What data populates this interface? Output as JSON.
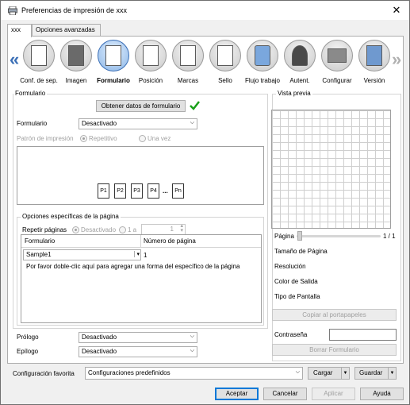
{
  "window": {
    "title": "Preferencias de impresión de xxx",
    "close_glyph": "✕"
  },
  "tabs": [
    {
      "label": "xxx"
    },
    {
      "label": "Opciones avanzadas"
    }
  ],
  "iconbar": {
    "items": [
      {
        "label": "Conf. de sep.",
        "icon": "page-setup-icon"
      },
      {
        "label": "Imagen",
        "icon": "image-icon"
      },
      {
        "label": "Formulario",
        "icon": "form-icon",
        "selected": true
      },
      {
        "label": "Posición",
        "icon": "position-icon"
      },
      {
        "label": "Marcas",
        "icon": "marks-icon"
      },
      {
        "label": "Sello",
        "icon": "stamp-icon"
      },
      {
        "label": "Flujo trabajo",
        "icon": "workflow-icon"
      },
      {
        "label": "Autent.",
        "icon": "authentication-icon"
      },
      {
        "label": "Configurar",
        "icon": "configure-icon"
      },
      {
        "label": "Versión",
        "icon": "version-icon"
      }
    ]
  },
  "formulario": {
    "group_label": "Formulario",
    "obtain_button": "Obtener datos de formulario",
    "form_label": "Formulario",
    "form_value": "Desactivado",
    "pattern_label": "Patrón de impresión",
    "pattern_repeat": "Repetitivo",
    "pattern_once": "Una vez",
    "pages": [
      "P1",
      "P2",
      "P3",
      "P4",
      "...",
      "Pn"
    ]
  },
  "page_options": {
    "group_label": "Opciones específicas de la página",
    "repeat_label": "Repetir páginas",
    "repeat_off": "Desactivado",
    "repeat_one": "1 a",
    "repeat_value": "1",
    "table": {
      "col_form": "Formulario",
      "col_page": "Número de página",
      "row_form": "Sample1",
      "row_page": "1",
      "hint": "Por favor doble-clic aquí para agregar una forma del específico de la página"
    }
  },
  "prologue": {
    "label": "Prólogo",
    "value": "Desactivado"
  },
  "epilogue": {
    "label": "Epílogo",
    "value": "Desactivado"
  },
  "preview": {
    "label": "Vista previa",
    "page_label": "Página",
    "page_count": "1 / 1",
    "rows": [
      "Tamaño de Página",
      "Resolución",
      "Color de Salida",
      "Tipo de Pantalla"
    ],
    "copy_button": "Copiar al portapapeles",
    "password_label": "Contraseña",
    "password_value": "",
    "delete_button": "Borrar Formulario"
  },
  "bottom": {
    "fav_label": "Configuración favorita",
    "fav_value": "Configuraciones predefinidos",
    "load_button": "Cargar",
    "save_button": "Guardar",
    "ok": "Aceptar",
    "cancel": "Cancelar",
    "apply": "Aplicar",
    "help": "Ayuda"
  },
  "colors": {
    "accent": "#3b6fb6",
    "check": "#1aa01a"
  }
}
